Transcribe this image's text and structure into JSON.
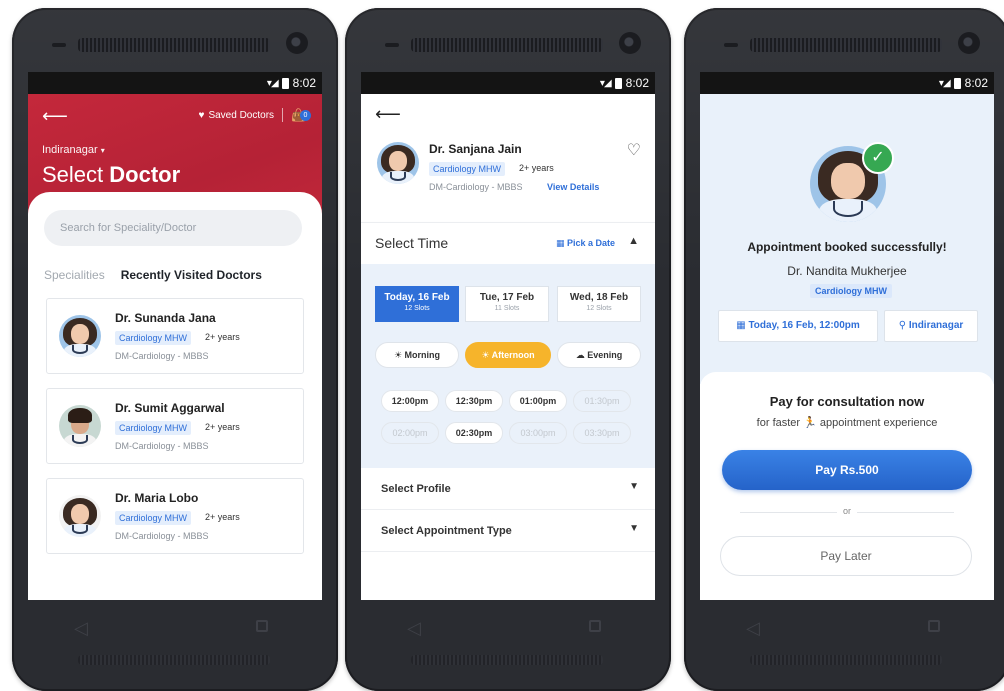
{
  "status": {
    "time": "8:02"
  },
  "phone1": {
    "header": {
      "saved_doctors": "Saved Doctors",
      "bag_count": "0",
      "location": "Indiranagar",
      "title_light": "Select",
      "title_bold": "Doctor"
    },
    "search": {
      "placeholder": "Search for Speciality/Doctor"
    },
    "tabs": {
      "specialities": "Specialities",
      "recent": "Recently Visited Doctors"
    },
    "doctors": [
      {
        "name": "Dr. Sunanda Jana",
        "speciality": "Cardiology MHW",
        "experience": "2+ years",
        "degree": "DM-Cardiology - MBBS"
      },
      {
        "name": "Dr. Sumit Aggarwal",
        "speciality": "Cardiology MHW",
        "experience": "2+ years",
        "degree": "DM-Cardiology - MBBS"
      },
      {
        "name": "Dr. Maria Lobo",
        "speciality": "Cardiology MHW",
        "experience": "2+ years",
        "degree": "DM-Cardiology - MBBS"
      }
    ]
  },
  "phone2": {
    "doctor": {
      "name": "Dr. Sanjana Jain",
      "speciality": "Cardiology MHW",
      "experience": "2+ years",
      "degree": "DM-Cardiology - MBBS",
      "view_details": "View Details"
    },
    "select_time": "Select Time",
    "pick_date": "Pick a Date",
    "dates": [
      {
        "label": "Today, 16 Feb",
        "slots": "12 Slots",
        "active": true
      },
      {
        "label": "Tue, 17 Feb",
        "slots": "11 Slots",
        "active": false
      },
      {
        "label": "Wed, 18 Feb",
        "slots": "12 Slots",
        "active": false
      }
    ],
    "periods": [
      {
        "label": "Morning",
        "active": false
      },
      {
        "label": "Afternoon",
        "active": true
      },
      {
        "label": "Evening",
        "active": false
      }
    ],
    "slots": [
      {
        "time": "12:00pm",
        "enabled": true
      },
      {
        "time": "12:30pm",
        "enabled": true
      },
      {
        "time": "01:00pm",
        "enabled": true
      },
      {
        "time": "01:30pm",
        "enabled": false
      },
      {
        "time": "02:00pm",
        "enabled": false
      },
      {
        "time": "02:30pm",
        "enabled": true
      },
      {
        "time": "03:00pm",
        "enabled": false
      },
      {
        "time": "03:30pm",
        "enabled": false
      }
    ],
    "select_profile": "Select Profile",
    "select_type": "Select Appointment Type"
  },
  "phone3": {
    "message": "Appointment booked successfully!",
    "doctor_name": "Dr. Nandita Mukherjee",
    "speciality": "Cardiology MHW",
    "datetime": "Today, 16 Feb, 12:00pm",
    "location": "Indiranagar",
    "pay_title": "Pay for consultation now",
    "pay_sub_1": "for faster",
    "pay_sub_2": "appointment experience",
    "pay_button": "Pay Rs.500",
    "or": "or",
    "pay_later": "Pay Later"
  },
  "colors": {
    "primary_red": "#c4283b",
    "primary_blue": "#2f6fd8",
    "accent_orange": "#f6b42b",
    "success_green": "#36a852"
  }
}
